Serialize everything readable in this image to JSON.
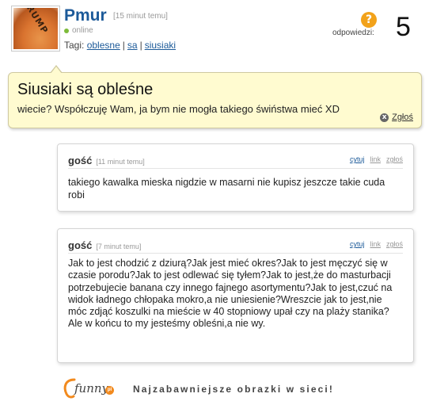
{
  "user": {
    "avatar_text": "RUMP",
    "name": "Pmur",
    "posted": "[15 minut temu]",
    "status": "online"
  },
  "tags": {
    "label": "Tagi:",
    "items": [
      "oblesne",
      "sa",
      "siusiaki"
    ]
  },
  "answers": {
    "badge": "?",
    "label": "odpowiedzi:",
    "count": "5"
  },
  "question": {
    "title": "Siusiaki są obleśne",
    "body": "wiecie? Współczuję Wam, ja bym nie mogła takiego świństwa mieć XD",
    "report_icon": "x",
    "report_label": "Zgłoś"
  },
  "comments": [
    {
      "author": "gość",
      "time": "[11 minut temu]",
      "actions": [
        "cytuj",
        "link",
        "zgłoś"
      ],
      "text": "takiego kawalka mieska nigdzie w masarni nie kupisz jeszcze takie cuda robi"
    },
    {
      "author": "gość",
      "time": "[7 minut temu]",
      "actions": [
        "cytuj",
        "link",
        "zgłoś"
      ],
      "text": "Jak to jest chodzić z dziurą?Jak jest mieć okres?Jak to jest męczyć się w czasie porodu?Jak to jest odlewać się tyłem?Jak to jest,że do masturbacji potrzebujecie banana czy innego fajnego asortymentu?Jak to jest,czuć na widok ładnego chłopaka mokro,a nie uniesienie?Wreszcie jak to jest,nie móc zdjąć koszulki na mieście w 40 stopniowy upał czy na plaży stanika?\nAle w końcu to my jesteśmy obleśni,a nie wy."
    }
  ],
  "footer": {
    "logo_text": "funny",
    "logo_badge": "pl",
    "slogan": "Najzabawniejsze obrazki w sieci!"
  },
  "colors": {
    "accent": "#1c5a99",
    "bubble": "#fffbd0",
    "badge": "#f2a21a",
    "online": "#7dbb3a"
  }
}
